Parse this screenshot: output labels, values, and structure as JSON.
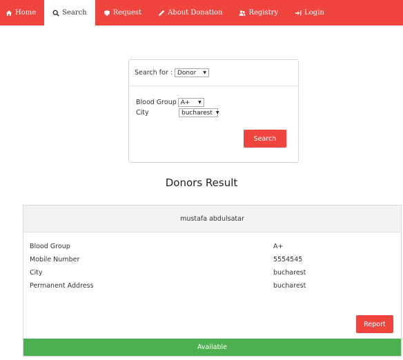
{
  "nav": {
    "items": [
      {
        "name": "nav-home",
        "icon": "home-icon",
        "label": "Home"
      },
      {
        "name": "nav-search",
        "icon": "search-icon",
        "label": "Search"
      },
      {
        "name": "nav-request",
        "icon": "shield-icon",
        "label": "Request"
      },
      {
        "name": "nav-about-donation",
        "icon": "pencil-icon",
        "label": "About Donation"
      },
      {
        "name": "nav-registry",
        "icon": "users-icon",
        "label": "Registry"
      },
      {
        "name": "nav-login",
        "icon": "login-icon",
        "label": "Login"
      }
    ],
    "active_index": 1,
    "color": "#f0453f"
  },
  "search": {
    "search_for_label": "Search for :",
    "search_for_value": "Donor",
    "blood_group_label": "Blood Group",
    "blood_group_value": "A+",
    "city_label": "City",
    "city_value": "bucharest",
    "button_label": "Search"
  },
  "result": {
    "title": "Donors Result",
    "donor_name": "mustafa abdulsatar",
    "fields": [
      {
        "label": "Blood Group",
        "value": "A+"
      },
      {
        "label": "Mobile Number",
        "value": "5554545"
      },
      {
        "label": "City",
        "value": "bucharest"
      },
      {
        "label": "Permanent Address",
        "value": "bucharest"
      }
    ],
    "report_label": "Report",
    "status_label": "Available",
    "status_color": "#4caf50"
  }
}
